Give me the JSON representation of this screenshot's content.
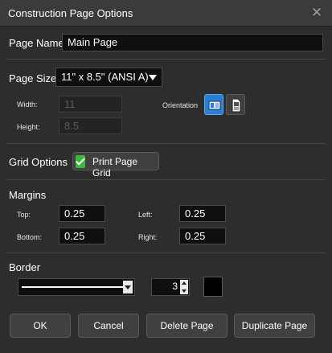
{
  "dialog": {
    "title": "Construction Page Options",
    "close_glyph": "✕"
  },
  "page_name": {
    "label": "Page Name",
    "value": "Main Page"
  },
  "page_size": {
    "label": "Page Size",
    "selected": "11\" x 8.5\" (ANSI A)"
  },
  "dimensions": {
    "width_label": "Width:",
    "width_value": "11",
    "height_label": "Height:",
    "height_value": "8.5"
  },
  "orientation": {
    "label": "Orientation",
    "selected": "landscape"
  },
  "grid_options": {
    "label": "Grid Options",
    "print_grid_label": "Print Page Grid",
    "checked": true
  },
  "margins": {
    "label": "Margins",
    "top_label": "Top:",
    "top_value": "0.25",
    "left_label": "Left:",
    "left_value": "0.25",
    "bottom_label": "Bottom:",
    "bottom_value": "0.25",
    "right_label": "Right:",
    "right_value": "0.25"
  },
  "border": {
    "label": "Border",
    "line_style": "solid",
    "width_value": "3",
    "color": "#000000"
  },
  "buttons": {
    "ok": "OK",
    "cancel": "Cancel",
    "delete_page": "Delete Page",
    "duplicate_page": "Duplicate Page"
  },
  "colors": {
    "background": "#2d2d2d",
    "accent": "#3a8ee6",
    "check": "#3db83d"
  }
}
